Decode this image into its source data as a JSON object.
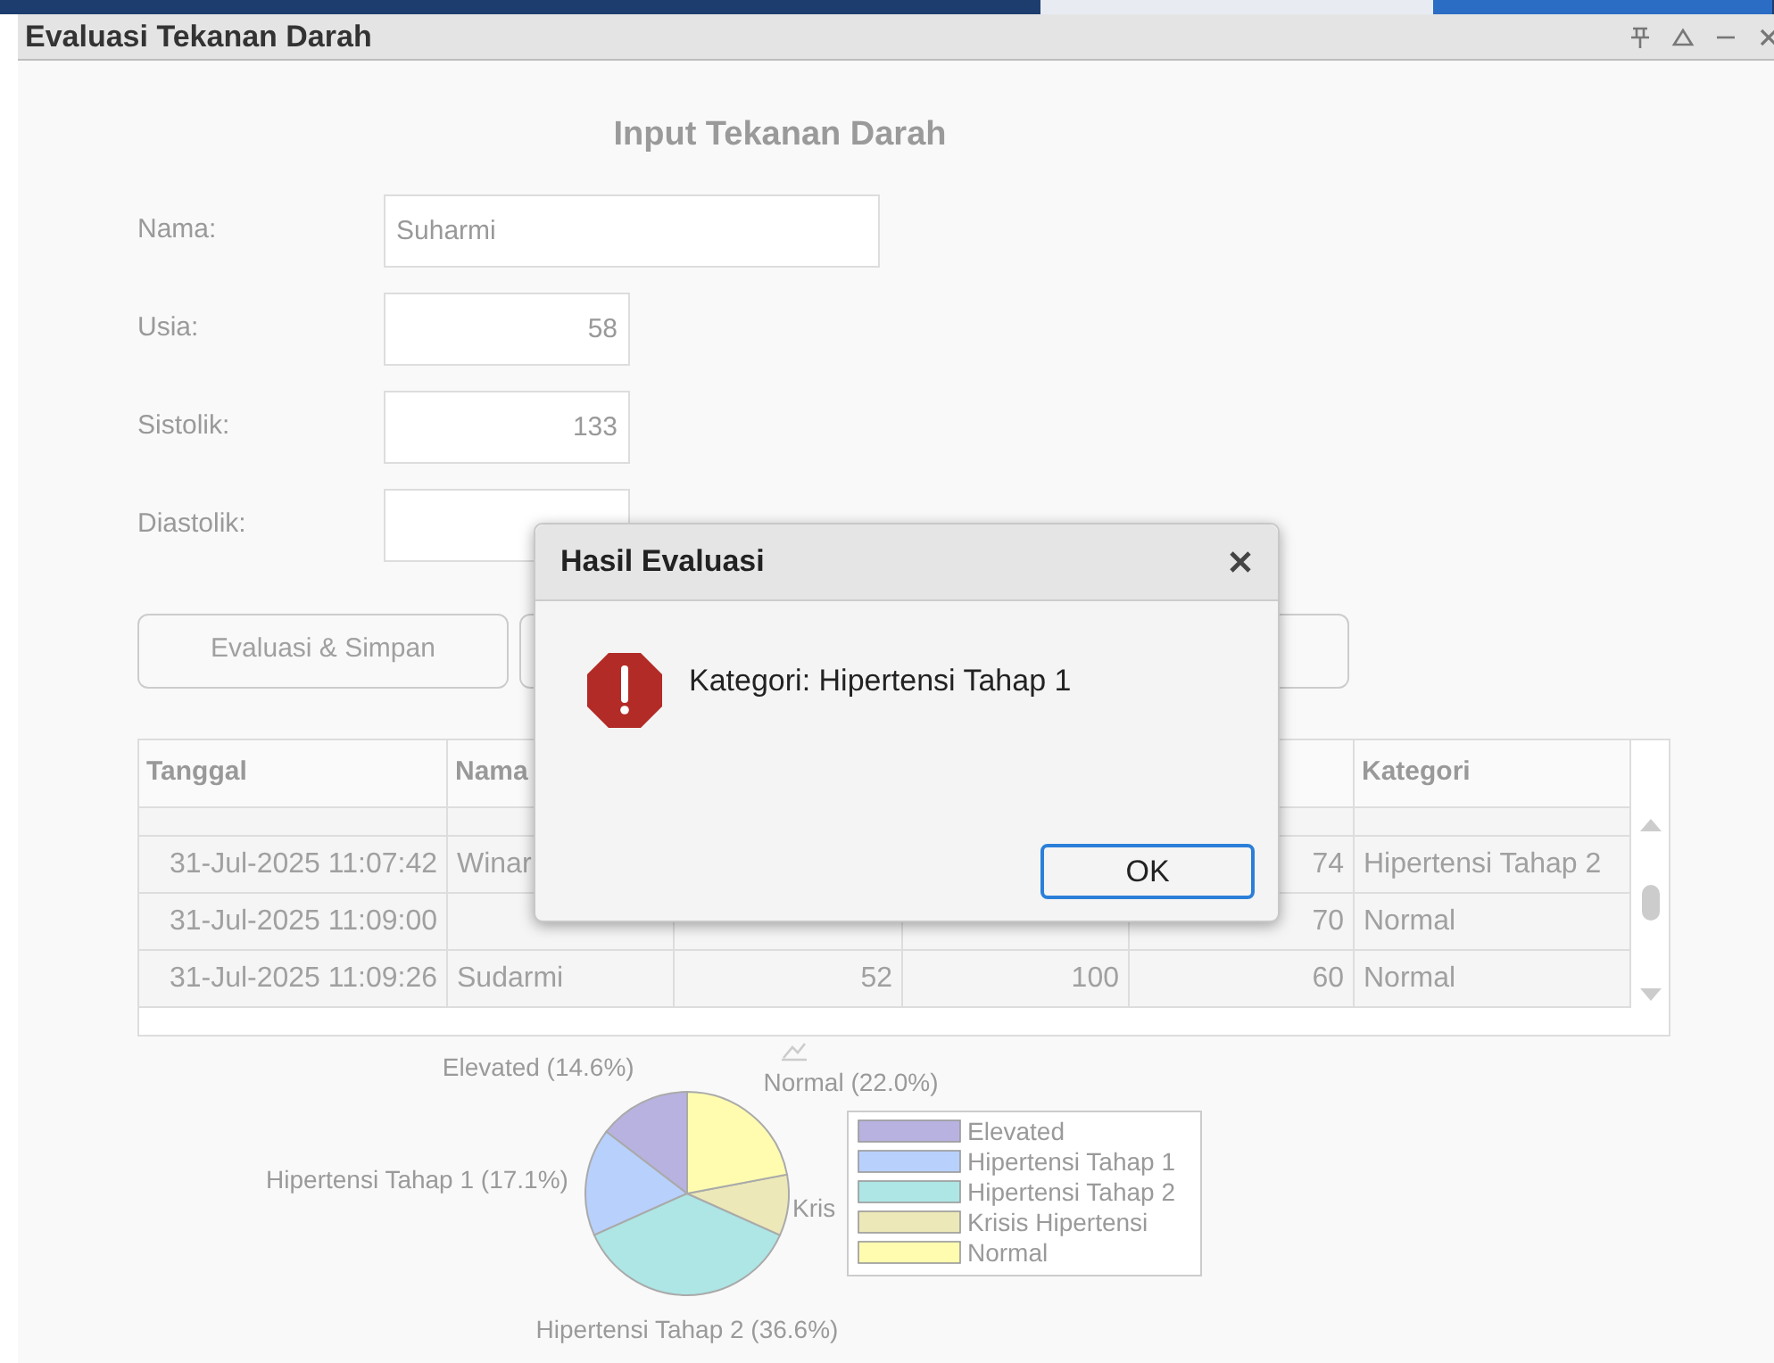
{
  "window": {
    "title": "Evaluasi Tekanan Darah"
  },
  "form": {
    "heading": "Input Tekanan Darah",
    "fields": [
      {
        "label": "Nama:",
        "value": "Suharmi"
      },
      {
        "label": "Usia:",
        "value": "58"
      },
      {
        "label": "Sistolik:",
        "value": "133"
      },
      {
        "label": "Diastolik:"
      }
    ],
    "buttons": [
      {
        "label": "Evaluasi & Simpan"
      }
    ]
  },
  "table": {
    "columns": [
      {
        "label": "Tanggal"
      },
      {
        "label": "Nama"
      },
      {},
      {},
      {},
      {
        "label": "Kategori"
      }
    ],
    "rows": [
      {
        "tanggal": "31-Jul-2025 11:07:42",
        "nama": "Winar",
        "column_5": "74",
        "kategori": "Hipertensi Tahap 2"
      },
      {
        "tanggal": "31-Jul-2025 11:09:00",
        "column_5": "70",
        "kategori": "Normal"
      },
      {
        "tanggal": "31-Jul-2025 11:09:26",
        "nama": "Sudarmi",
        "column_3": "52",
        "column_4": "100",
        "column_5": "60",
        "kategori": "Normal"
      }
    ]
  },
  "chart_data": {
    "type": "pie",
    "legend": "right",
    "categories": [
      "Elevated",
      "Hipertensi Tahap 1",
      "Hipertensi Tahap 2",
      "Krisis Hipertensi",
      "Normal"
    ],
    "values": [
      14.6,
      17.1,
      36.6,
      9.7,
      22.0
    ],
    "colors": [
      "#b8b2e0",
      "#b8d0fc",
      "#ade6e5",
      "#ece8b8",
      "#fffcb0"
    ],
    "value_labels": [
      "Elevated (14.6%)",
      "Hipertensi Tahap 1 (17.1%)",
      "Hipertensi Tahap 2 (36.6%)",
      "Kris",
      "Normal (22.0%)"
    ]
  },
  "dialog": {
    "title": "Hasil Evaluasi",
    "message": "Kategori: Hipertensi Tahap 1",
    "button": "OK"
  }
}
